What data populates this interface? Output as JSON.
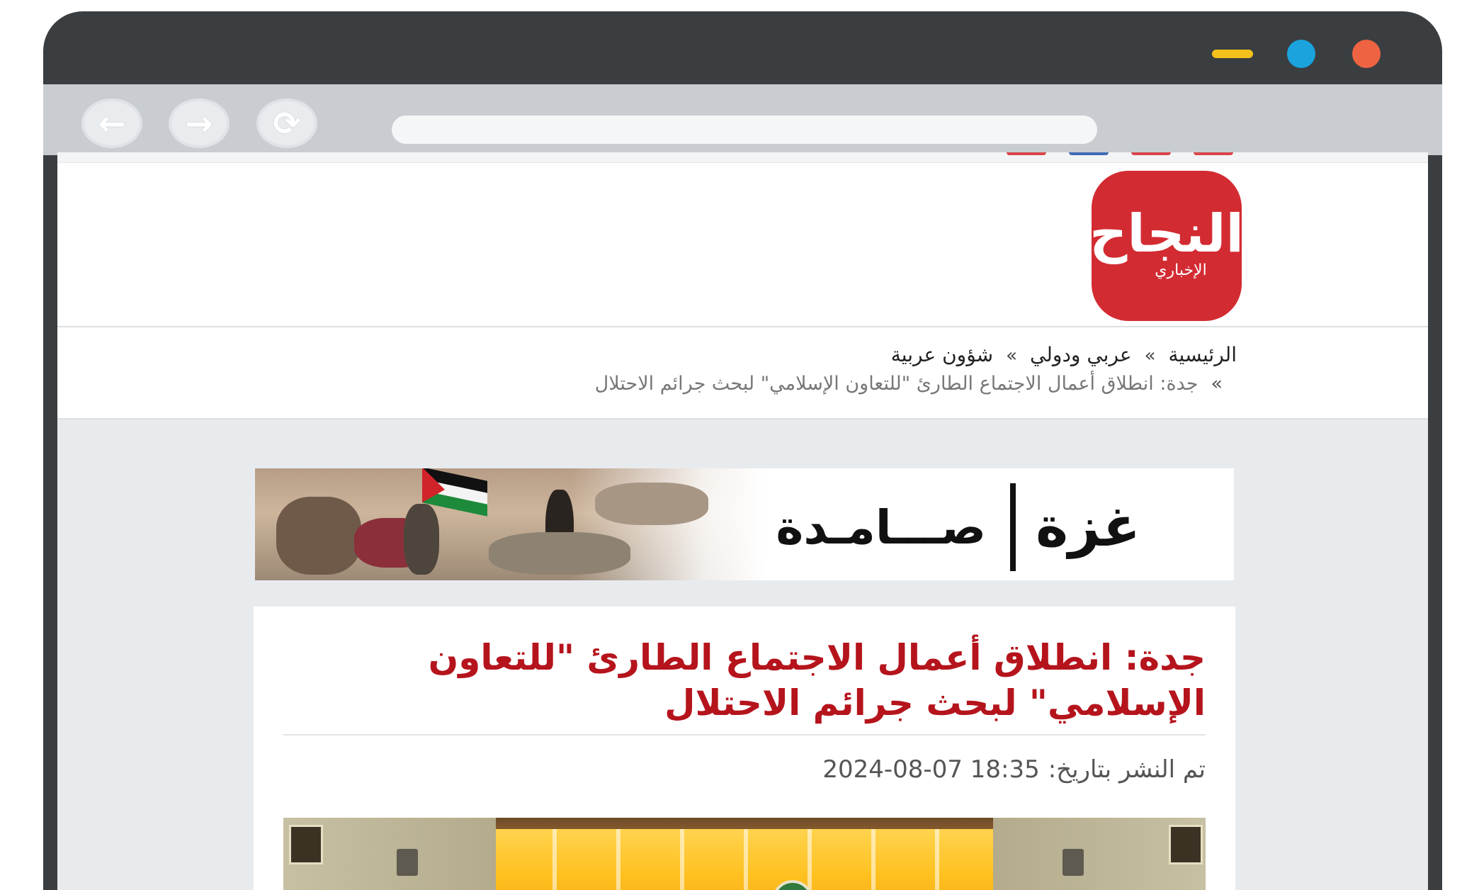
{
  "window": {
    "controls": [
      {
        "name": "minimize",
        "color": "#f2c21b"
      },
      {
        "name": "maximize",
        "color": "#1aa3dd"
      },
      {
        "name": "close",
        "color": "#ee6442"
      }
    ]
  },
  "toolbar": {
    "back_icon": "←",
    "forward_icon": "→",
    "reload_icon": "⟳",
    "address_value": ""
  },
  "site": {
    "logo_main": "النجاح",
    "logo_sub": "الإخباري",
    "brand_color": "#d32b32"
  },
  "breadcrumb": {
    "items": [
      "الرئيسية",
      "عربي ودولي",
      "شؤون عربية"
    ],
    "separator": "»",
    "current": "جدة: انطلاق أعمال الاجتماع الطارئ \"للتعاون الإسلامي\" لبحث جرائم الاحتلال"
  },
  "banner": {
    "word1": "غزة",
    "word2": "صـــامـدة"
  },
  "article": {
    "title": "جدة: انطلاق أعمال الاجتماع الطارئ \"للتعاون الإسلامي\" لبحث جرائم الاحتلال",
    "date_label": "تم النشر بتاريخ:",
    "date_value": "2024-08-07 18:35",
    "title_color": "#b5141c"
  }
}
